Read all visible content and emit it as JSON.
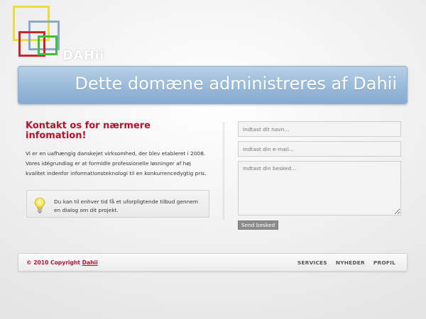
{
  "brand": {
    "name": "DAHii"
  },
  "header": {
    "title": "Dette domæne administreres af Dahii"
  },
  "contact": {
    "heading": "Kontakt os for nærmere infomation!",
    "intro": "Vi er en uafhængig danskejet virksomhed, der blev etableret i 2008. Vores idégrundlag er at formidle professionelle løsninger af høj kvalitet indenfor informationsteknologi til en konkurrencedygtig pris.",
    "tip": "Du kan til enhver tid få et uforpligtende tilbud gennem en dialog om dit projekt."
  },
  "form": {
    "name_placeholder": "Indtast dit navn...",
    "email_placeholder": "Indtast din e-mail...",
    "message_placeholder": "Indtast din besked...",
    "submit_label": "Send besked"
  },
  "footer": {
    "copyright_prefix": "© 2010 Copyright ",
    "copyright_link": "Dahii",
    "nav": [
      "SERVICES",
      "NYHEDER",
      "PROFIL"
    ]
  },
  "colors": {
    "accent_red": "#b8102c",
    "banner_blue": "#9bbcda",
    "button_gray": "#8b8b8b"
  },
  "icons": {
    "logo": "overlapping-squares-logo-icon",
    "tip": "lightbulb-icon"
  }
}
